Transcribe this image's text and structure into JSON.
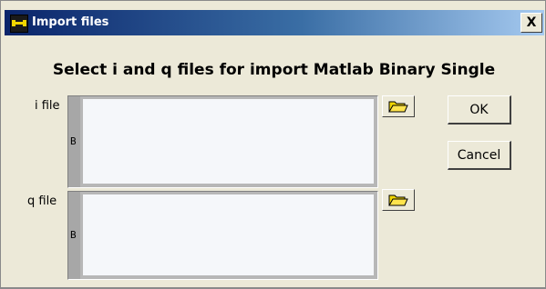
{
  "window": {
    "title": "Import files",
    "close_label": "X"
  },
  "heading": "Select i and q files for import Matlab Binary Single",
  "fields": {
    "i": {
      "label": "i file",
      "marker": "Β"
    },
    "q": {
      "label": "q file",
      "marker": "Β"
    }
  },
  "buttons": {
    "ok": "OK",
    "cancel": "Cancel"
  },
  "icons": {
    "app": "matlab-app-icon",
    "browse": "open-folder-icon",
    "close": "close-icon"
  },
  "colors": {
    "titlebar_start": "#0a246a",
    "titlebar_end": "#a6caf0",
    "dialog_bg": "#ece9d8",
    "folder_fill": "#f2d600"
  }
}
